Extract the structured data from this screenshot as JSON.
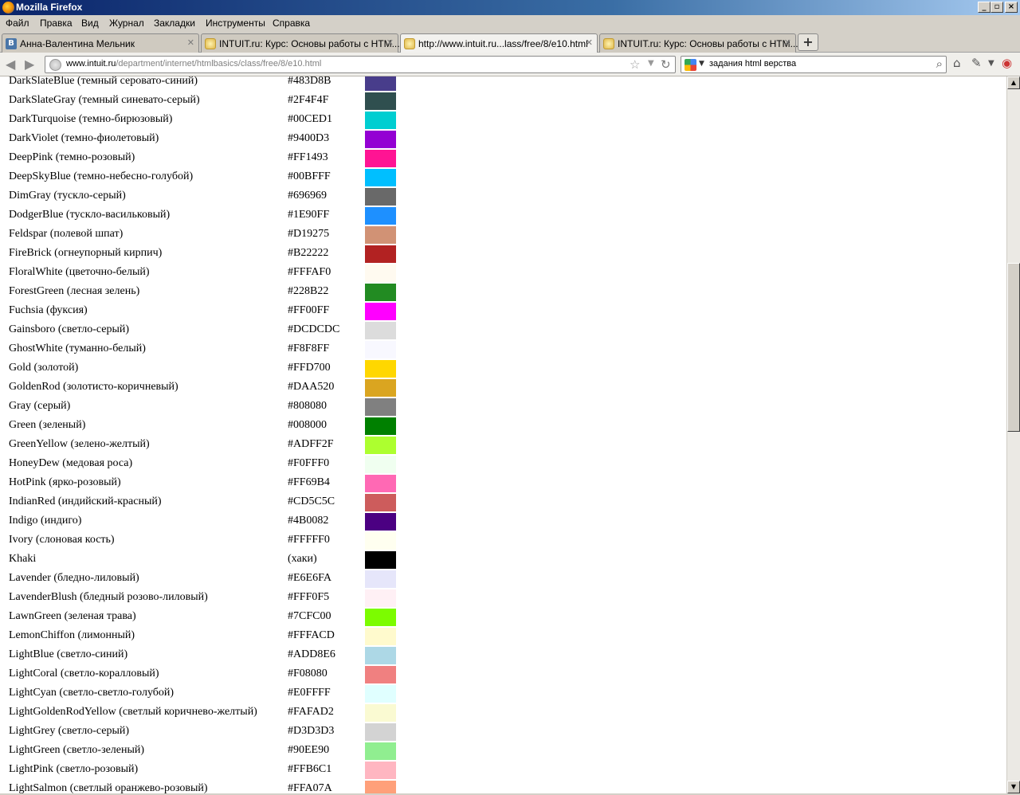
{
  "window": {
    "title": "Mozilla Firefox"
  },
  "menu": [
    "Файл",
    "Правка",
    "Вид",
    "Журнал",
    "Закладки",
    "Инструменты",
    "Справка"
  ],
  "tabs": [
    {
      "label": "Анна-Валентина Мельник",
      "icon": "vk-icon",
      "active": false
    },
    {
      "label": "INTUIT.ru: Курс: Основы работы с HTM...",
      "icon": "intuit-icon",
      "active": false
    },
    {
      "label": "http://www.intuit.ru...lass/free/8/e10.html",
      "icon": "intuit-icon",
      "active": true
    },
    {
      "label": "INTUIT.ru: Курс: Основы работы с HTM...",
      "icon": "intuit-icon",
      "active": false
    }
  ],
  "navbar": {
    "url_host": "www.intuit.ru",
    "url_path": "/department/internet/htmlbasics/class/free/8/e10.html",
    "search_query": "задания html верства"
  },
  "colors": [
    {
      "name": "DarkSlateBlue (темный серовато-синий)",
      "code": "#483D8B",
      "swatch": "#483D8B"
    },
    {
      "name": "DarkSlateGray (темный синевато-серый)",
      "code": "#2F4F4F",
      "swatch": "#2F4F4F"
    },
    {
      "name": "DarkTurquoise (темно-бирюзовый)",
      "code": "#00CED1",
      "swatch": "#00CED1"
    },
    {
      "name": "DarkViolet (темно-фиолетовый)",
      "code": "#9400D3",
      "swatch": "#9400D3"
    },
    {
      "name": "DeepPink (темно-розовый)",
      "code": "#FF1493",
      "swatch": "#FF1493"
    },
    {
      "name": "DeepSkyBlue (темно-небесно-голубой)",
      "code": "#00BFFF",
      "swatch": "#00BFFF"
    },
    {
      "name": "DimGray (тускло-серый)",
      "code": "#696969",
      "swatch": "#696969"
    },
    {
      "name": "DodgerBlue (тускло-васильковый)",
      "code": "#1E90FF",
      "swatch": "#1E90FF"
    },
    {
      "name": "Feldspar (полевой шпат)",
      "code": "#D19275",
      "swatch": "#D19275"
    },
    {
      "name": "FireBrick (огнеупорный кирпич)",
      "code": "#B22222",
      "swatch": "#B22222"
    },
    {
      "name": "FloralWhite (цветочно-белый)",
      "code": "#FFFAF0",
      "swatch": "#FFFAF0"
    },
    {
      "name": "ForestGreen (лесная зелень)",
      "code": "#228B22",
      "swatch": "#228B22"
    },
    {
      "name": "Fuchsia (фуксия)",
      "code": "#FF00FF",
      "swatch": "#FF00FF"
    },
    {
      "name": "Gainsboro (светло-серый)",
      "code": "#DCDCDC",
      "swatch": "#DCDCDC"
    },
    {
      "name": "GhostWhite (туманно-белый)",
      "code": "#F8F8FF",
      "swatch": "#F8F8FF"
    },
    {
      "name": "Gold (золотой)",
      "code": "#FFD700",
      "swatch": "#FFD700"
    },
    {
      "name": "GoldenRod (золотисто-коричневый)",
      "code": "#DAA520",
      "swatch": "#DAA520"
    },
    {
      "name": "Gray (серый)",
      "code": "#808080",
      "swatch": "#808080"
    },
    {
      "name": "Green (зеленый)",
      "code": "#008000",
      "swatch": "#008000"
    },
    {
      "name": "GreenYellow (зелено-желтый)",
      "code": "#ADFF2F",
      "swatch": "#ADFF2F"
    },
    {
      "name": "HoneyDew (медовая роса)",
      "code": "#F0FFF0",
      "swatch": "#F0FFF0"
    },
    {
      "name": "HotPink (ярко-розовый)",
      "code": "#FF69B4",
      "swatch": "#FF69B4"
    },
    {
      "name": "IndianRed (индийский-красный)",
      "code": "#CD5C5C",
      "swatch": "#CD5C5C"
    },
    {
      "name": "Indigo (индиго)",
      "code": "#4B0082",
      "swatch": "#4B0082"
    },
    {
      "name": "Ivory (слоновая кость)",
      "code": "#FFFFF0",
      "swatch": "#FFFFF0"
    },
    {
      "name": "Khaki",
      "code": "(хаки)",
      "swatch": "#000000"
    },
    {
      "name": "Lavender (бледно-лиловый)",
      "code": "#E6E6FA",
      "swatch": "#E6E6FA"
    },
    {
      "name": "LavenderBlush (бледный розово-лиловый)",
      "code": "#FFF0F5",
      "swatch": "#FFF0F5"
    },
    {
      "name": "LawnGreen (зеленая трава)",
      "code": "#7CFC00",
      "swatch": "#7CFC00"
    },
    {
      "name": "LemonChiffon (лимонный)",
      "code": "#FFFACD",
      "swatch": "#FFFACD"
    },
    {
      "name": "LightBlue (светло-синий)",
      "code": "#ADD8E6",
      "swatch": "#ADD8E6"
    },
    {
      "name": "LightCoral (светло-коралловый)",
      "code": "#F08080",
      "swatch": "#F08080"
    },
    {
      "name": "LightCyan (светло-светло-голубой)",
      "code": "#E0FFFF",
      "swatch": "#E0FFFF"
    },
    {
      "name": "LightGoldenRodYellow (светлый коричнево-желтый)",
      "code": "#FAFAD2",
      "swatch": "#FAFAD2"
    },
    {
      "name": "LightGrey (светло-серый)",
      "code": "#D3D3D3",
      "swatch": "#D3D3D3"
    },
    {
      "name": "LightGreen (светло-зеленый)",
      "code": "#90EE90",
      "swatch": "#90EE90"
    },
    {
      "name": "LightPink (светло-розовый)",
      "code": "#FFB6C1",
      "swatch": "#FFB6C1"
    },
    {
      "name": "LightSalmon (светлый оранжево-розовый)",
      "code": "#FFA07A",
      "swatch": "#FFA07A"
    }
  ]
}
